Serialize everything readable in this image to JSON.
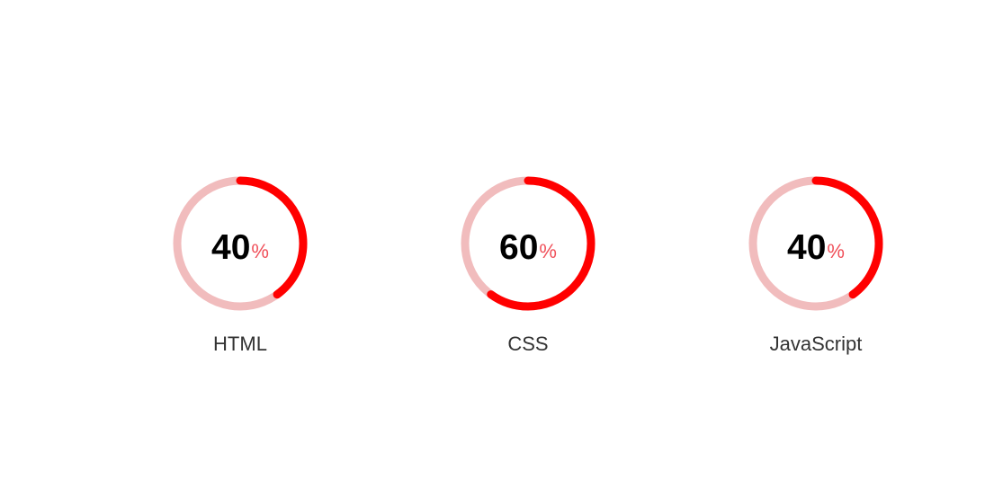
{
  "colors": {
    "track": "#f1bcbd",
    "progress": "#ff0000",
    "number": "#000000",
    "percent_sign": "#f0505a",
    "label": "#333333"
  },
  "skills": [
    {
      "label": "HTML",
      "value": "40",
      "percent_sign": "%",
      "progress": 0.4
    },
    {
      "label": "CSS",
      "value": "60",
      "percent_sign": "%",
      "progress": 0.6
    },
    {
      "label": "JavaScript",
      "value": "40",
      "percent_sign": "%",
      "progress": 0.4
    }
  ]
}
